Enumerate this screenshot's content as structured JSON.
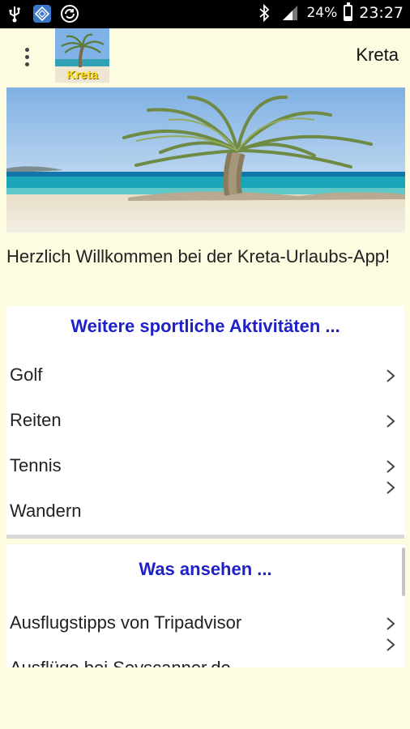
{
  "status_bar": {
    "icons_left": [
      "usb-icon",
      "app-notification-icon",
      "sync-icon"
    ],
    "icons_right": [
      "bluetooth-icon",
      "signal-icon"
    ],
    "battery_percent": "24%",
    "battery_level": 0.24,
    "time": "23:27"
  },
  "appbar": {
    "menu_icon": "overflow-menu-icon",
    "logo_text": "Kreta",
    "title": "Kreta"
  },
  "hero": {
    "image": "palm-tree-beach"
  },
  "welcome_text": "Herzlich Willkommen bei der Kreta-Urlaubs-App!",
  "sections": [
    {
      "header": "Weitere sportliche Aktivitäten ...",
      "items": [
        {
          "label": "Golf"
        },
        {
          "label": "Reiten"
        },
        {
          "label": "Tennis"
        },
        {
          "label": "Wandern"
        }
      ]
    },
    {
      "header": "Was ansehen ...",
      "items": [
        {
          "label": "Ausflugstipps von Tripadvisor"
        },
        {
          "label": "Ausflüge bei Seyscanner.de"
        }
      ]
    }
  ],
  "colors": {
    "background": "#fdfbe0",
    "section_header": "#1f21c8",
    "status_bar": "#000000"
  }
}
